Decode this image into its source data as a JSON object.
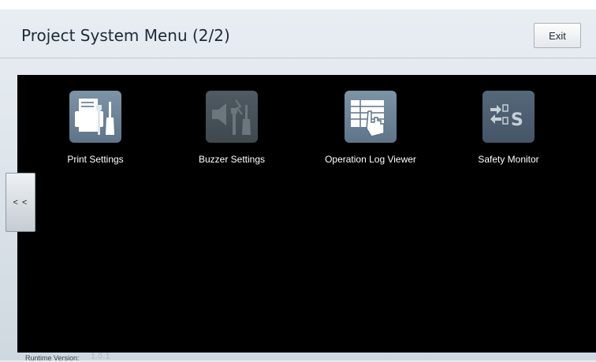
{
  "header": {
    "title": "Project System Menu (2/2)",
    "exit_label": "Exit"
  },
  "menu": {
    "items": [
      {
        "label": "Print Settings",
        "icon": "printer-wrench-icon",
        "enabled": true
      },
      {
        "label": "Buzzer Settings",
        "icon": "speaker-wrench-icon",
        "enabled": false
      },
      {
        "label": "Operation Log Viewer",
        "icon": "log-hand-icon",
        "enabled": true
      },
      {
        "label": "Safety Monitor",
        "icon": "safety-monitor-icon",
        "enabled": true
      }
    ]
  },
  "nav": {
    "prev_label": "< <"
  },
  "footer": {
    "runtime_label": "Runtime Version:",
    "runtime_value": "1.0.1"
  }
}
